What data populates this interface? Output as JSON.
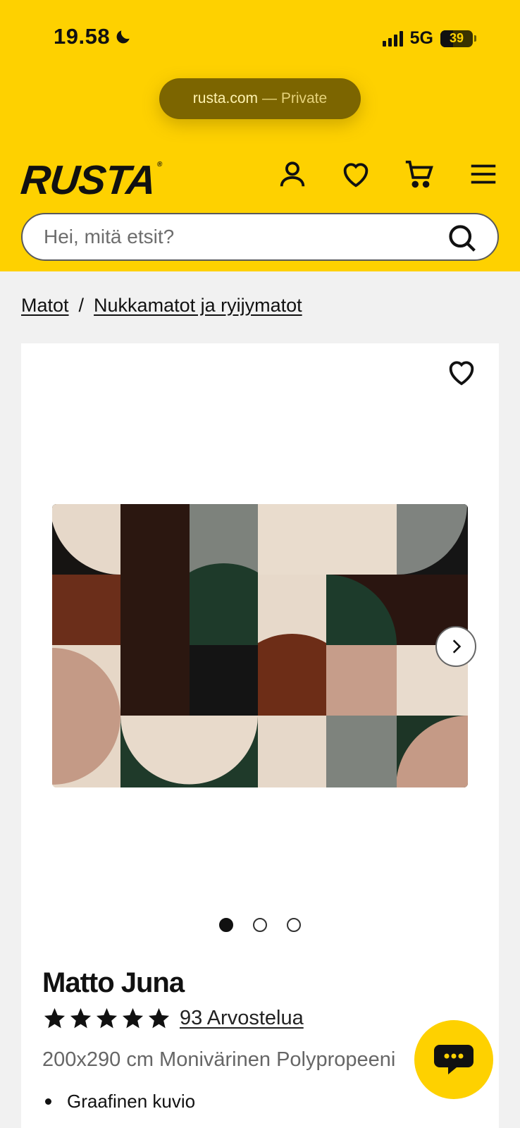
{
  "status_bar": {
    "time": "19.58",
    "network": "5G",
    "battery": "39"
  },
  "browser": {
    "domain": "rusta.com",
    "mode": "— Private"
  },
  "header": {
    "logo": "RUSTA",
    "logo_mark": "®"
  },
  "search": {
    "placeholder": "Hei, mitä etsit?"
  },
  "breadcrumb": {
    "items": [
      "Matot",
      "Nukkamatot ja ryijymatot"
    ],
    "separator": "/"
  },
  "product": {
    "title": "Matto Juna",
    "rating": 5,
    "reviews_label": "93 Arvostelua",
    "subtitle": "200x290 cm Monivärinen Polypropeeni",
    "bullets": [
      "Graafinen kuvio"
    ],
    "gallery": {
      "total": 3,
      "active": 1
    }
  },
  "colors": {
    "brand_yellow": "#FED100",
    "text": "#111111"
  },
  "icons": [
    "moon-icon",
    "account-icon",
    "wishlist-icon",
    "cart-icon",
    "menu-icon",
    "search-icon",
    "heart-icon",
    "chevron-right-icon",
    "star-icon",
    "chat-icon"
  ]
}
